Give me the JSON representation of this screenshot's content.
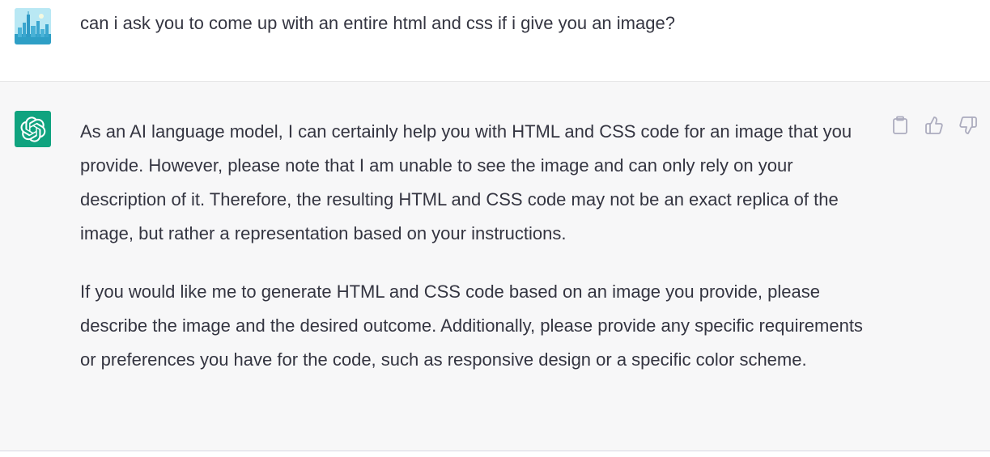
{
  "conversation": {
    "user_message": {
      "text": "can i ask you to come up with an entire html and css if i give you an image?",
      "avatar_icon": "city-skyline-avatar-icon"
    },
    "assistant_message": {
      "avatar_icon": "openai-logo-icon",
      "paragraphs": [
        "As an AI language model, I can certainly help you with HTML and CSS code for an image that you provide. However, please note that I am unable to see the image and can only rely on your description of it. Therefore, the resulting HTML and CSS code may not be an exact replica of the image, but rather a representation based on your instructions.",
        "If you would like me to generate HTML and CSS code based on an image you provide, please describe the image and the desired outcome. Additionally, please provide any specific requirements or preferences you have for the code, such as responsive design or a specific color scheme."
      ],
      "actions": [
        {
          "icon": "clipboard-icon"
        },
        {
          "icon": "thumbs-up-icon"
        },
        {
          "icon": "thumbs-down-icon"
        }
      ]
    }
  },
  "colors": {
    "user_bg": "#ffffff",
    "assistant_bg": "#f7f7f8",
    "text": "#343541",
    "brand_green": "#10a37f",
    "icon_gray": "#acacbe"
  }
}
